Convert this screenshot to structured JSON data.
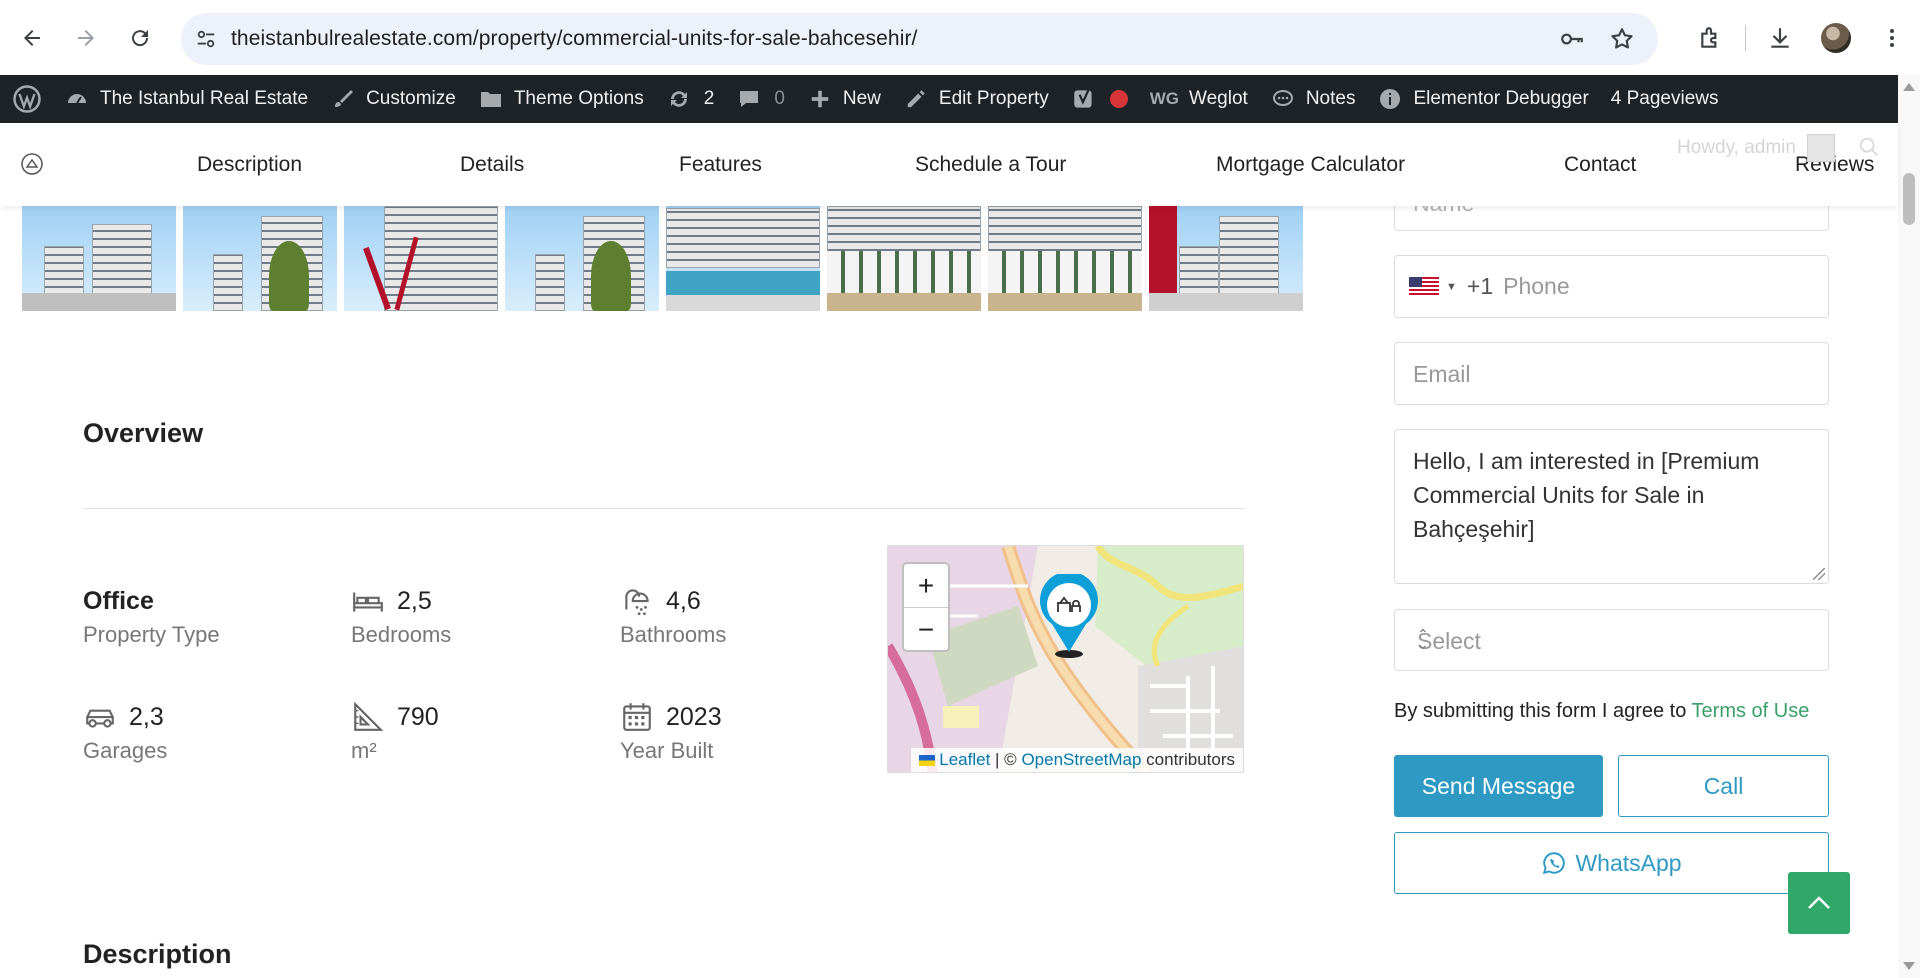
{
  "browser": {
    "url": "theistanbulrealestate.com/property/commercial-units-for-sale-bahcesehir/",
    "icons": [
      "back-icon",
      "forward-icon",
      "reload-icon",
      "site-settings-icon",
      "password-key-icon",
      "bookmark-star-icon",
      "extensions-icon",
      "download-icon",
      "profile-avatar",
      "menu-dots-icon"
    ]
  },
  "adminbar": {
    "site_name": "The Istanbul Real Estate",
    "customize": "Customize",
    "theme_options": "Theme Options",
    "updates_count": "2",
    "comments_count": "0",
    "new": "New",
    "edit_property": "Edit Property",
    "weglot": "Weglot",
    "notes": "Notes",
    "elementor_debugger": "Elementor Debugger",
    "pageviews": "4 Pageviews",
    "howdy": "Howdy, admin"
  },
  "section_nav": {
    "items": [
      "Description",
      "Details",
      "Features",
      "Schedule a Tour",
      "Mortgage Calculator",
      "Contact",
      "Reviews"
    ]
  },
  "overview": {
    "title": "Overview",
    "features": [
      {
        "value": "Office",
        "label": "Property Type",
        "icon": "none"
      },
      {
        "value": "2,5",
        "label": "Bedrooms",
        "icon": "bed-icon"
      },
      {
        "value": "4,6",
        "label": "Bathrooms",
        "icon": "shower-icon"
      },
      {
        "value": "2,3",
        "label": "Garages",
        "icon": "car-icon"
      },
      {
        "value": "790",
        "label": "m²",
        "icon": "ruler-triangle-icon"
      },
      {
        "value": "2023",
        "label": "Year Built",
        "icon": "calendar-icon"
      }
    ]
  },
  "map": {
    "zoom_in": "+",
    "zoom_out": "−",
    "attribution_leaflet": "Leaflet",
    "attribution_sep": " | © ",
    "attribution_osm": "OpenStreetMap",
    "attribution_contrib": " contributors"
  },
  "description": {
    "title": "Description"
  },
  "contact_form": {
    "name_placeholder": "Name",
    "phone_code": "+1",
    "phone_placeholder": "Phone",
    "email_placeholder": "Email",
    "message": "Hello, I am interested in [Premium Commercial Units for Sale in Bahçeşehir]",
    "select_placeholder": "Select",
    "terms_text": "By submitting this form I agree to ",
    "terms_link": "Terms of Use",
    "send_button": "Send Message",
    "call_button": "Call",
    "whatsapp_button": "WhatsApp"
  },
  "colors": {
    "accent_blue": "#2e9ac4",
    "accent_green": "#2fa86a",
    "adminbar_bg": "#1d2327"
  }
}
